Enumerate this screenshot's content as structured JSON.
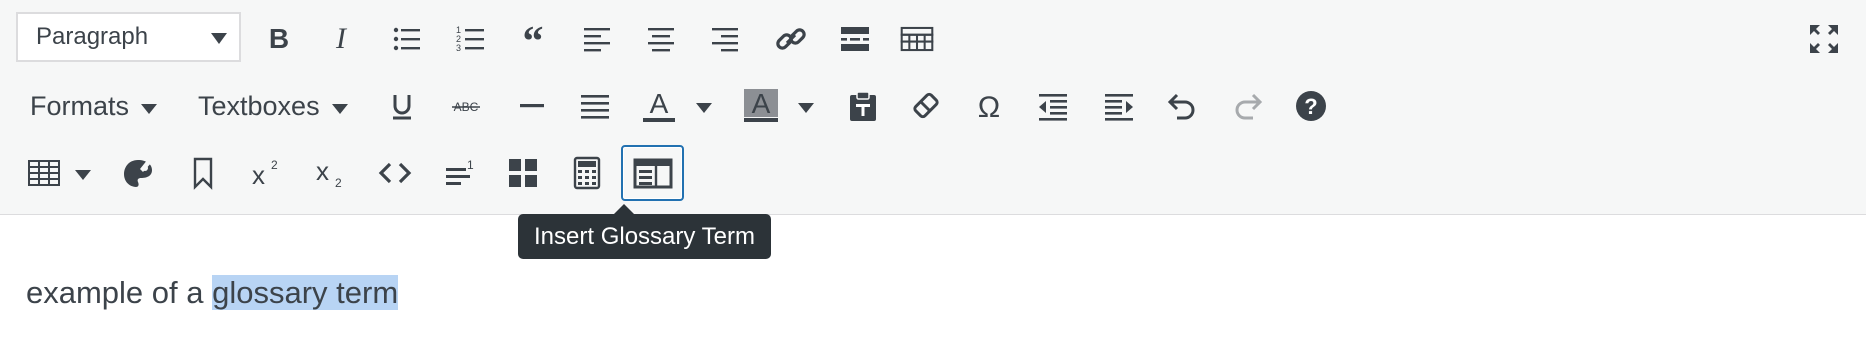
{
  "toolbar": {
    "format_select": {
      "value": "Paragraph"
    },
    "formats_menu": "Formats",
    "textboxes_menu": "Textboxes",
    "text_color_letter": "A",
    "background_color_letter": "A",
    "icons": [
      "bold-icon",
      "italic-icon",
      "bulleted-list-icon",
      "numbered-list-icon",
      "blockquote-icon",
      "align-left-icon",
      "align-center-icon",
      "align-right-icon",
      "link-icon",
      "read-more-icon",
      "toolbar-toggle-icon",
      "fullscreen-icon",
      "underline-icon",
      "strikethrough-icon",
      "horizontal-line-icon",
      "justify-icon",
      "text-color-icon",
      "background-color-icon",
      "paste-as-text-icon",
      "clear-formatting-icon",
      "special-character-icon",
      "outdent-icon",
      "indent-icon",
      "undo-icon",
      "redo-icon",
      "help-icon",
      "table-icon",
      "palette-icon",
      "bookmark-icon",
      "superscript-icon",
      "subscript-icon",
      "code-icon",
      "footnote-icon",
      "blocks-icon",
      "calculator-icon",
      "glossary-icon"
    ]
  },
  "tooltip": {
    "text": "Insert Glossary Term"
  },
  "content": {
    "text_before": "example of a ",
    "selected_text": "glossary term"
  },
  "colors": {
    "active_border": "#2271b1",
    "selection": "#b8d4f4",
    "tooltip_bg": "#2c3338"
  }
}
